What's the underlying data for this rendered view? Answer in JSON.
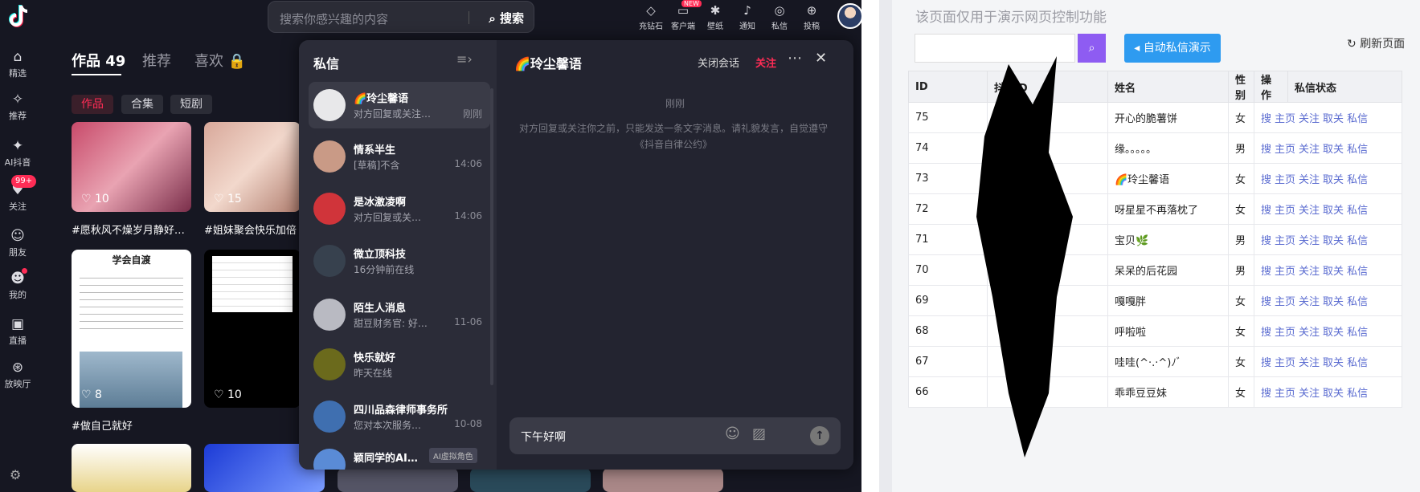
{
  "search": {
    "placeholder": "搜索你感兴趣的内容",
    "button": "搜索"
  },
  "nav": [
    {
      "label": "精选",
      "icon": "home-icon",
      "glyph": "⌂"
    },
    {
      "label": "推荐",
      "icon": "sparkle-icon",
      "glyph": "✧"
    },
    {
      "label": "AI抖音",
      "icon": "ai-icon",
      "glyph": "✦"
    },
    {
      "label": "关注",
      "icon": "follow-icon",
      "glyph": "♥",
      "badge": "99+"
    },
    {
      "label": "朋友",
      "icon": "friends-icon",
      "glyph": "☺"
    },
    {
      "label": "我的",
      "icon": "profile-icon",
      "glyph": "☻"
    },
    {
      "label": "直播",
      "icon": "tv-icon",
      "glyph": "▣"
    },
    {
      "label": "放映厅",
      "icon": "cinema-icon",
      "glyph": "⊛"
    }
  ],
  "topbar": [
    {
      "label": "充钻石",
      "icon": "diamond-icon",
      "glyph": "◇"
    },
    {
      "label": "客户端",
      "icon": "client-icon",
      "glyph": "▭",
      "tag": "NEW"
    },
    {
      "label": "壁纸",
      "icon": "wallpaper-icon",
      "glyph": "✱"
    },
    {
      "label": "通知",
      "icon": "bell-icon",
      "glyph": "♪"
    },
    {
      "label": "私信",
      "icon": "message-icon",
      "glyph": "◎"
    },
    {
      "label": "投稿",
      "icon": "upload-icon",
      "glyph": "⊕"
    }
  ],
  "profile": {
    "tabs": {
      "works": "作品 49",
      "recommend": "推荐",
      "likes": "喜欢 🔒"
    },
    "subtabs": [
      "作品",
      "合集",
      "短剧"
    ]
  },
  "videos": [
    {
      "likes": "10",
      "title": "#愿秋风不燥岁月静好…"
    },
    {
      "likes": "15",
      "title": "#姐妹聚会快乐加倍"
    },
    {
      "likes": "8",
      "title": "#做自己就好",
      "heading": "学会自渡"
    },
    {
      "likes": "10"
    }
  ],
  "dm": {
    "title": "私信",
    "conversations": [
      {
        "name": "🌈玲尘馨语",
        "preview": "对方回复或关注…",
        "time": "刚刚",
        "color": "#e8e8ea"
      },
      {
        "name": "情系半生",
        "preview": "[草稿]不含",
        "time": "14:06",
        "color": "#c99a86"
      },
      {
        "name": "是冰激凌啊",
        "preview": "对方回复或关…",
        "time": "14:06",
        "color": "#d0343a"
      },
      {
        "name": "微立顶科技",
        "preview": "16分钟前在线",
        "time": "",
        "color": "#37414e"
      },
      {
        "name": "陌生人消息",
        "preview": "甜豆财务官: 好…",
        "time": "11-06",
        "color": "#b9bac2"
      },
      {
        "name": "快乐就好",
        "preview": "昨天在线",
        "time": "",
        "color": "#6b6a1c"
      },
      {
        "name": "四川品森律师事务所",
        "preview": "您对本次服务…",
        "time": "10-08",
        "color": "#3f6fb0"
      },
      {
        "name": "颖同学的AI…",
        "preview": "",
        "time": "",
        "color": "#5a8bd6",
        "tag": "AI虚拟角色"
      }
    ],
    "chat": {
      "name": "🌈玲尘馨语",
      "close": "关闭会话",
      "follow": "关注",
      "time": "刚刚",
      "notice": "对方回复或关注你之前，只能发送一条文字消息。请礼貌发言，自觉遵守《抖音自律公约》",
      "input": "下午好啊"
    }
  },
  "panel": {
    "notice": "该页面仅用于演示网页控制功能",
    "search_icon": "search-icon",
    "auto_btn": "自动私信演示",
    "refresh": "刷新页面",
    "columns": [
      "ID",
      "抖音ID",
      "姓名",
      "性别",
      "操作",
      "私信状态"
    ],
    "ops": [
      "搜",
      "主页",
      "关注",
      "取关",
      "私信"
    ],
    "rows": [
      {
        "id": "75",
        "name": "开心的脆薯饼",
        "gender": "女"
      },
      {
        "id": "74",
        "name": "缘。。。。。",
        "gender": "男"
      },
      {
        "id": "73",
        "name": "🌈玲尘馨语",
        "gender": "女"
      },
      {
        "id": "72",
        "name": "呀星星不再落枕了",
        "gender": "女"
      },
      {
        "id": "71",
        "name": "宝贝🌿",
        "gender": "男"
      },
      {
        "id": "70",
        "name": "呆呆的后花园",
        "gender": "男"
      },
      {
        "id": "69",
        "name": "嘎嘎胖",
        "gender": "女"
      },
      {
        "id": "68",
        "name": "呼啦啦",
        "gender": "女"
      },
      {
        "id": "67",
        "name": "哇哇(^·.·^)ﾉﾞ",
        "gender": "女"
      },
      {
        "id": "66",
        "name": "乖乖豆豆妹",
        "gender": "女"
      }
    ]
  }
}
